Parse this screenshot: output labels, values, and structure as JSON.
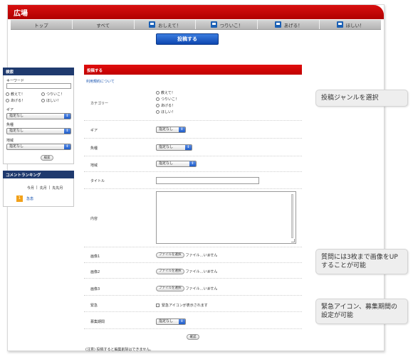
{
  "header": {
    "title": "広場"
  },
  "nav": {
    "tabs": [
      {
        "label": "トップ",
        "icon": ""
      },
      {
        "label": "すべて",
        "icon": ""
      },
      {
        "label": "おしえて！",
        "icon": "category-icon"
      },
      {
        "label": "つりいこ！",
        "icon": "category-icon"
      },
      {
        "label": "あげる！",
        "icon": "category-icon"
      },
      {
        "label": "ほしい！",
        "icon": "category-icon"
      }
    ]
  },
  "post_button": "投稿する",
  "sidebar": {
    "search_title": "検索",
    "keyword_label": "キーワード",
    "keyword_value": "",
    "radios": [
      "教えて！",
      "つりいこ！",
      "あげる！",
      "ほしい！"
    ],
    "gear_label": "ギア",
    "gear_value": "指定なし",
    "fish_label": "魚種",
    "fish_value": "指定なし",
    "area_label": "地域",
    "area_value": "指定なし",
    "search_button": "検索",
    "ranking_title": "コメントランキング",
    "ranking_periods": [
      "今月",
      "先月",
      "先先月"
    ],
    "ranking_sep": "|",
    "ranking_items": [
      {
        "rank": "1",
        "name": "急患"
      }
    ]
  },
  "form": {
    "title": "投稿する",
    "terms_link": "利用規約について",
    "category_label": "カテゴリー",
    "categories": [
      "教えて！",
      "つりいこ！",
      "あげる！",
      "ほしい！"
    ],
    "gear_label": "ギア",
    "gear_value": "指定なし",
    "fish_label": "魚種",
    "fish_value": "指定なし",
    "area_label": "地域",
    "area_value": "指定なし",
    "title_label": "タイトル",
    "title_value": "",
    "content_label": "内容",
    "content_value": "",
    "image1_label": "画像1",
    "image2_label": "画像2",
    "image3_label": "画像3",
    "file_button": "ファイルを選択",
    "file_status": "ファイル…いません",
    "urgent_label": "緊急",
    "urgent_text": "緊急アイコンが表示されます",
    "period_label": "募集期間",
    "period_value": "指定なし",
    "confirm_button": "確認",
    "note": "(注意) 投稿すると編集削除はできません。"
  },
  "callouts": {
    "genre": "投稿ジャンルを選択",
    "images": "質問には3枚まで画像をUPすることが可能",
    "urgent": "緊急アイコン、募集期間の設定が可能"
  },
  "colors": {
    "header_red": "#d81010",
    "post_blue": "#1f5cc9",
    "sidebar_navy": "#1f3a6e",
    "rank_badge": "#f2a11a"
  }
}
